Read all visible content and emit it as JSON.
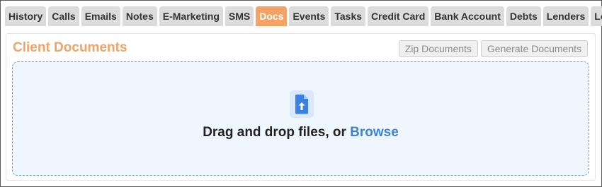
{
  "tabs": [
    {
      "label": "History",
      "active": false
    },
    {
      "label": "Calls",
      "active": false
    },
    {
      "label": "Emails",
      "active": false
    },
    {
      "label": "Notes",
      "active": false
    },
    {
      "label": "E-Marketing",
      "active": false
    },
    {
      "label": "SMS",
      "active": false
    },
    {
      "label": "Docs",
      "active": true
    },
    {
      "label": "Events",
      "active": false
    },
    {
      "label": "Tasks",
      "active": false
    },
    {
      "label": "Credit Card",
      "active": false
    },
    {
      "label": "Bank Account",
      "active": false
    },
    {
      "label": "Debts",
      "active": false
    },
    {
      "label": "Lenders",
      "active": false
    },
    {
      "label": "Loans",
      "active": false
    }
  ],
  "panel": {
    "title": "Client Documents",
    "zip_button": "Zip Documents",
    "generate_button": "Generate Documents"
  },
  "dropzone": {
    "text": "Drag and drop files, or",
    "browse_link": "Browse",
    "icon": "file-upload-icon"
  },
  "colors": {
    "accent": "#f7a265",
    "tab_bg": "#dcdcdc",
    "link": "#3b82e0",
    "dropzone_bg": "#f0f6fe",
    "dropzone_border": "#6c9ad8"
  }
}
